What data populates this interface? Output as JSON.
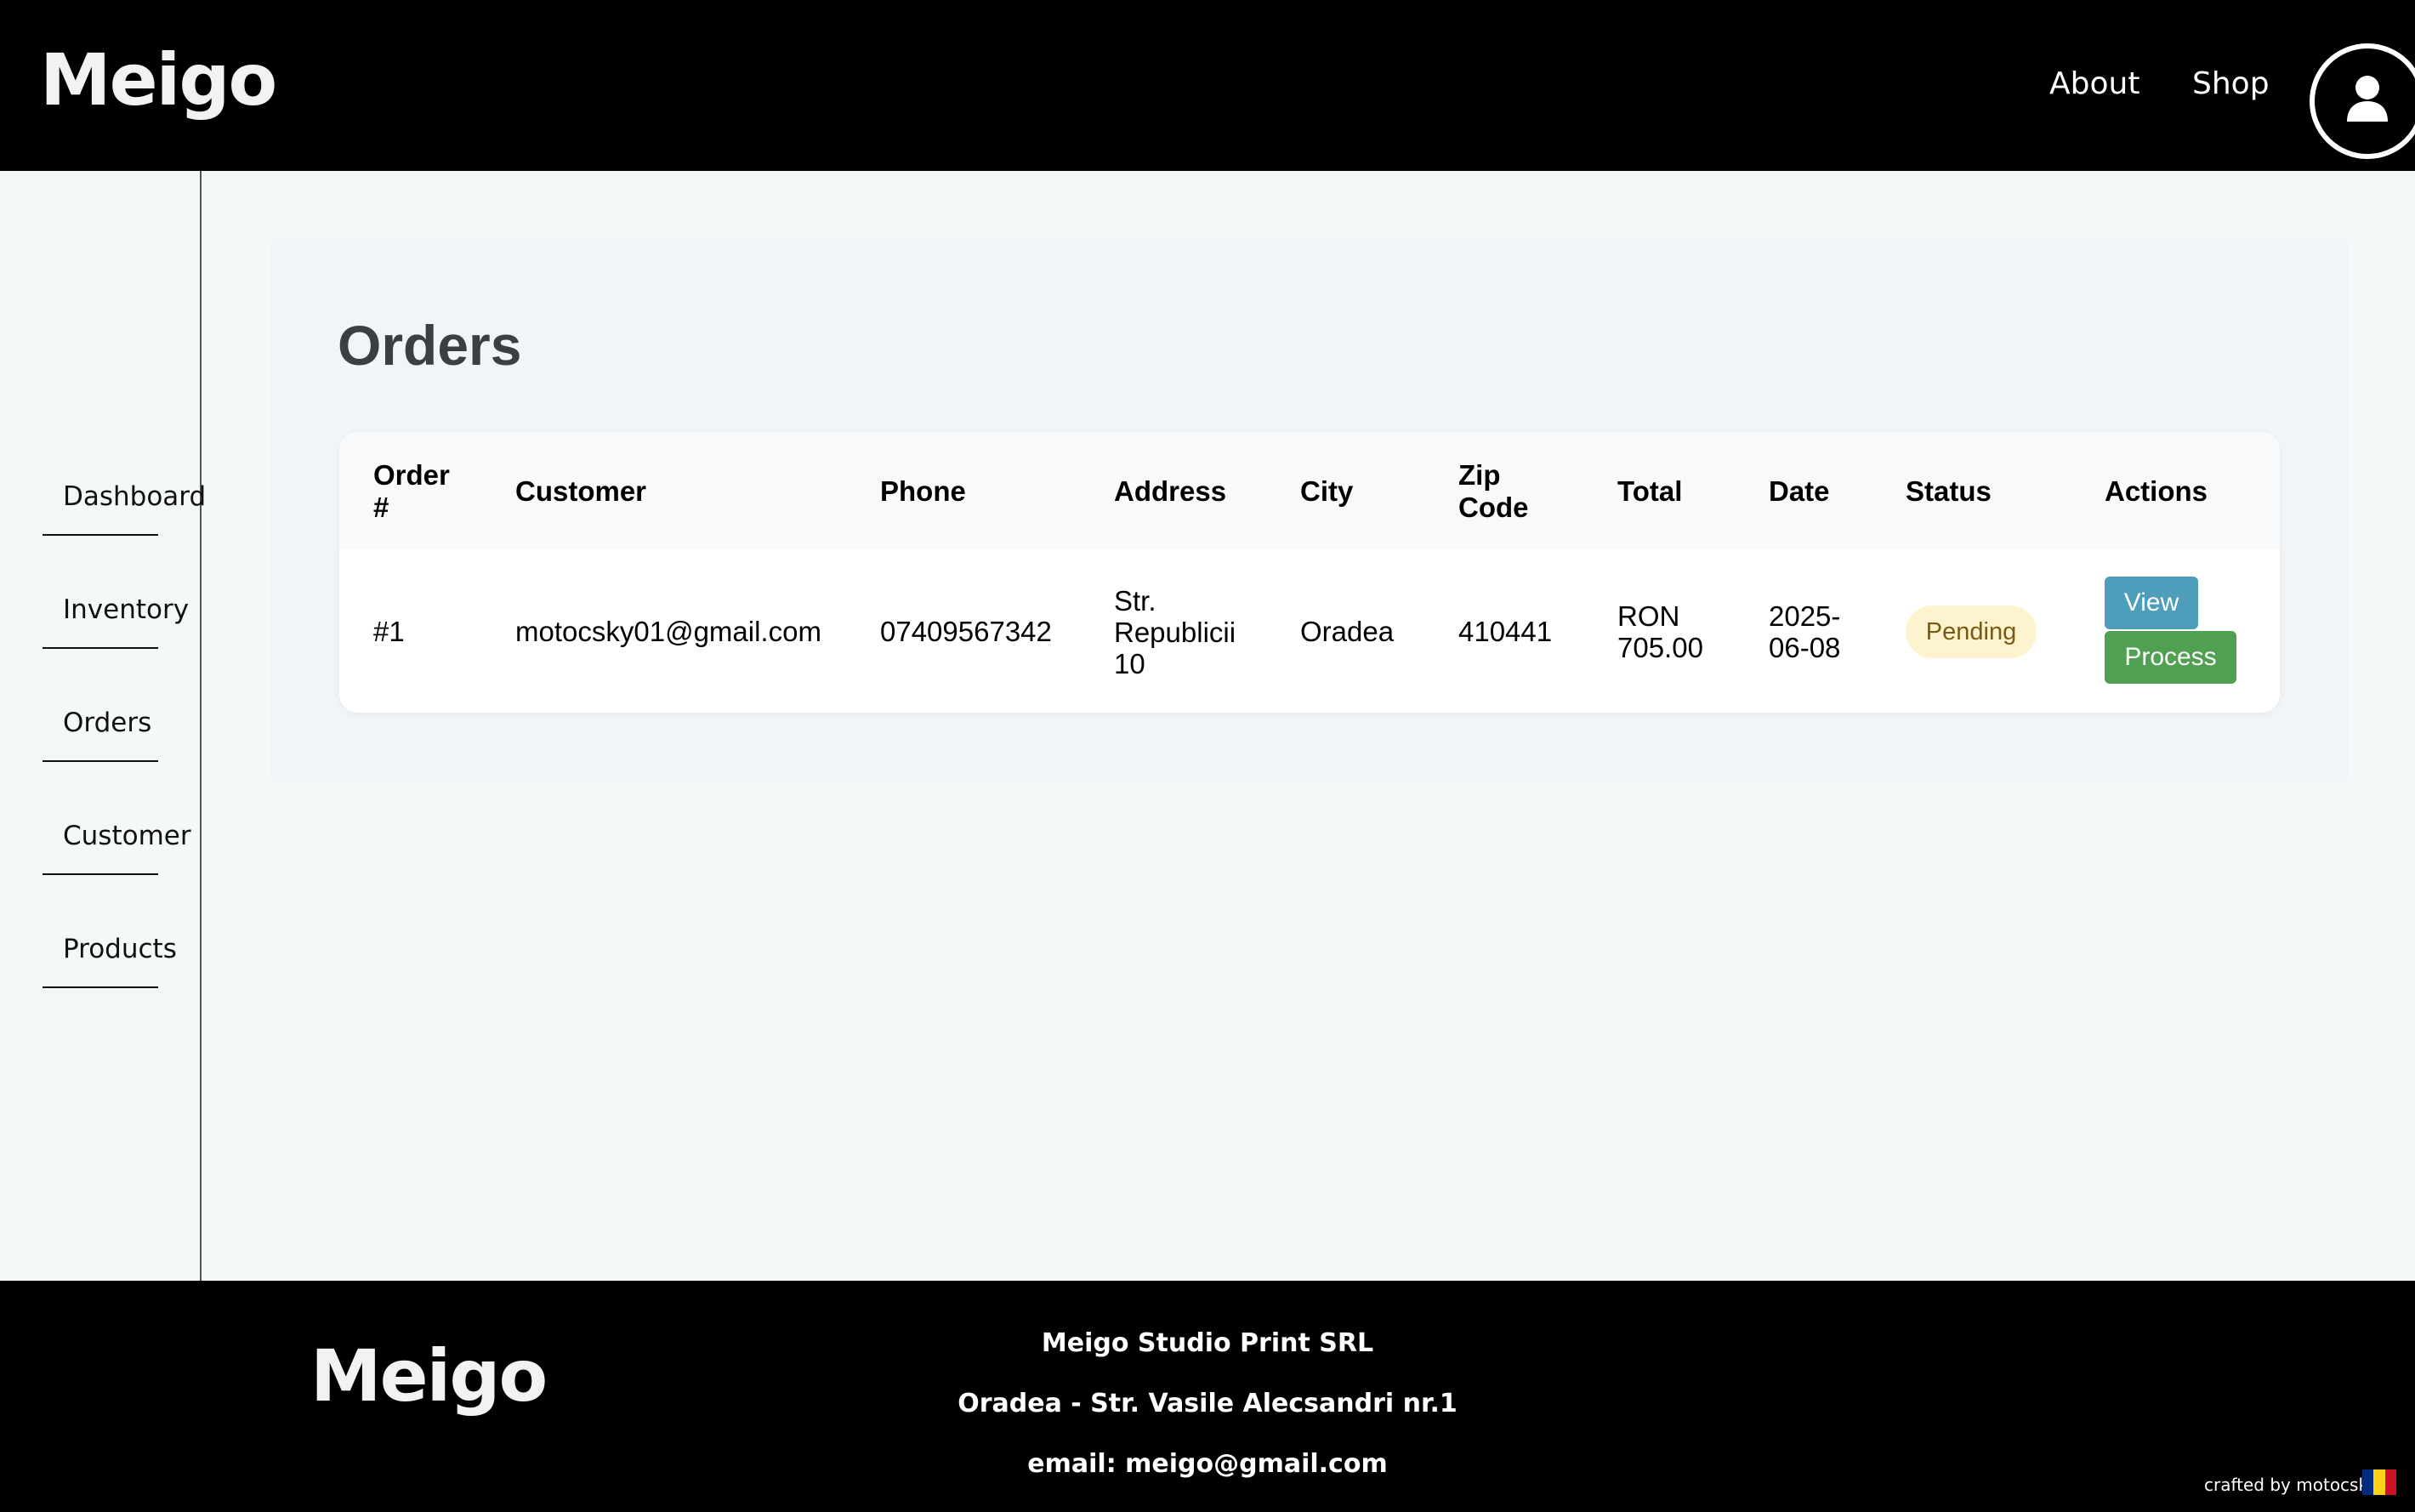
{
  "header": {
    "logo": "Meigo",
    "nav": {
      "about": "About",
      "shop": "Shop"
    },
    "account_icon": "user-icon"
  },
  "sidebar": {
    "items": [
      {
        "label": "Dashboard"
      },
      {
        "label": "Inventory"
      },
      {
        "label": "Orders"
      },
      {
        "label": "Customer"
      },
      {
        "label": "Products"
      }
    ]
  },
  "main": {
    "title": "Orders",
    "table": {
      "headers": {
        "order": "Order #",
        "customer": "Customer",
        "phone": "Phone",
        "address": "Address",
        "city": "City",
        "zip": "Zip Code",
        "total": "Total",
        "date": "Date",
        "status": "Status",
        "actions": "Actions"
      },
      "rows": [
        {
          "order": "#1",
          "customer": "motocsky01@gmail.com",
          "phone": "07409567342",
          "address": "Str. Republicii 10",
          "city": "Oradea",
          "zip": "410441",
          "total": "RON 705.00",
          "date": "2025-06-08",
          "status": "Pending",
          "view_label": "View",
          "process_label": "Process"
        }
      ]
    }
  },
  "footer": {
    "logo": "Meigo",
    "company": "Meigo Studio Print SRL",
    "address": "Oradea - Str. Vasile Alecsandri nr.1",
    "email": "email: meigo@gmail.com",
    "credit": "crafted by motocsky",
    "flag_colors": [
      "#002B7F",
      "#FCD116",
      "#CE1126"
    ]
  },
  "colors": {
    "status_pending_bg": "#fdf3cf",
    "view_button": "#4d9dbb",
    "process_button": "#4fa050"
  }
}
